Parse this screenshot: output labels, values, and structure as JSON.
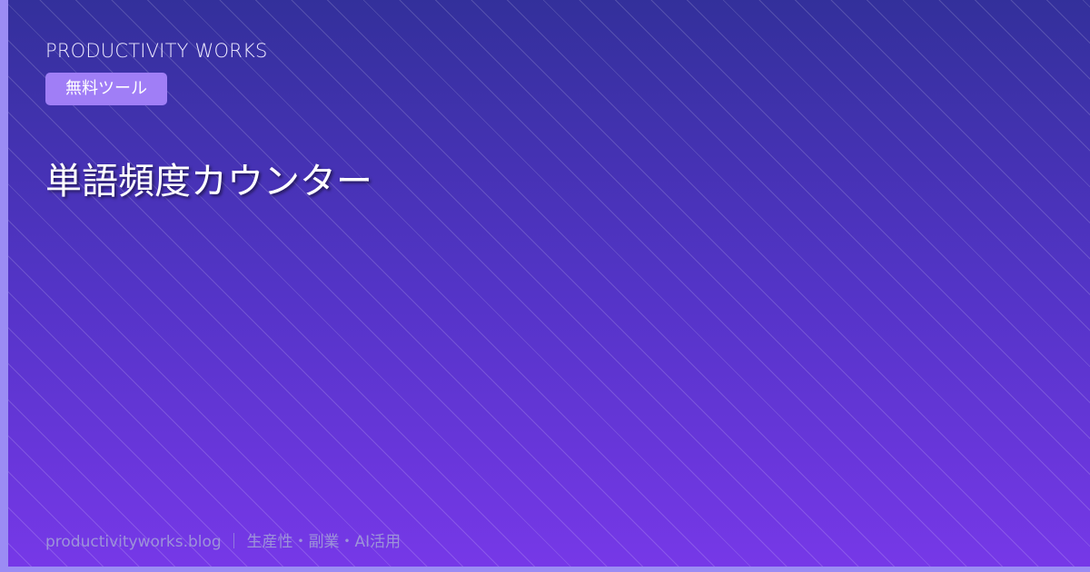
{
  "brand": {
    "name": "PRODUCTIVITY WORKS"
  },
  "badge": {
    "label": "無料ツール"
  },
  "title": "単語頻度カウンター",
  "footer": {
    "text": "productivityworks.blog ｜ 生産性・副業・AI活用"
  },
  "colors": {
    "gradient_top": "#33309b",
    "gradient_bottom": "#7738e8",
    "badge": "#a07ef6",
    "accent": "#9b8cf4"
  }
}
